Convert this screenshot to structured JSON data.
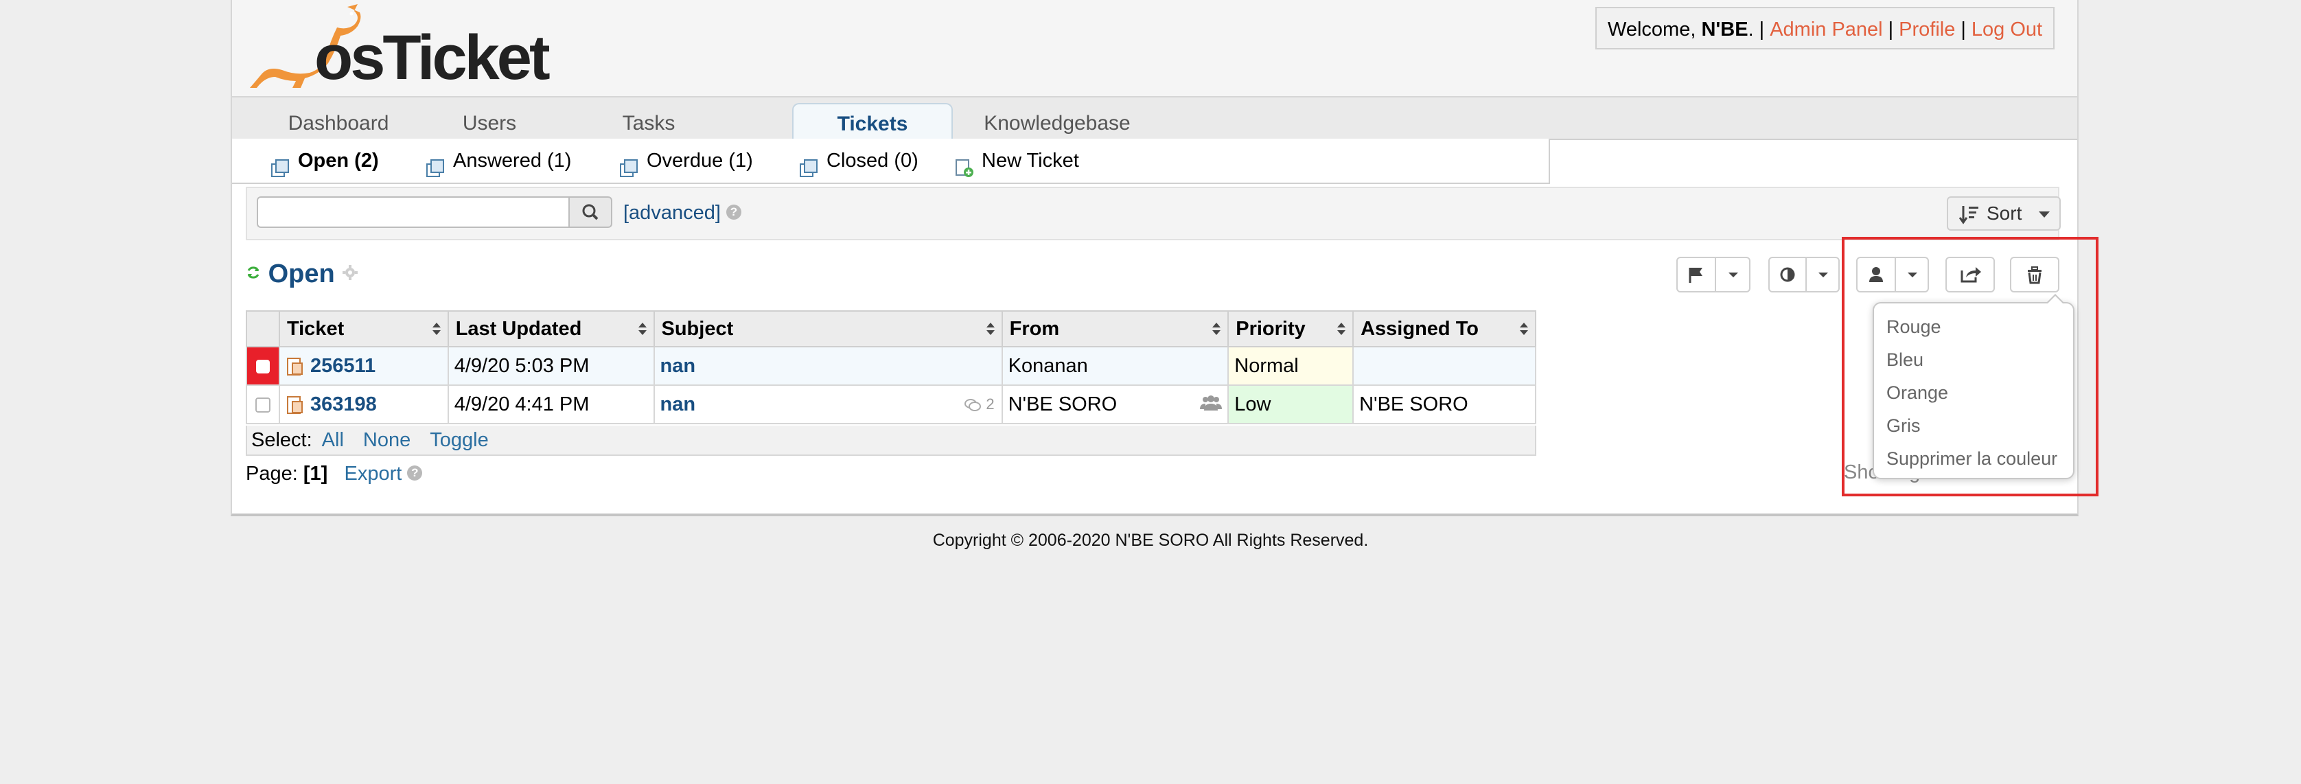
{
  "header": {
    "logo_text": "osTicket",
    "welcome_prefix": "Welcome, ",
    "username": "N'BE",
    "welcome_suffix": ".",
    "links": [
      "Admin Panel",
      "Profile",
      "Log Out"
    ]
  },
  "nav": {
    "tabs": [
      "Dashboard",
      "Users",
      "Tasks",
      "Tickets",
      "Knowledgebase"
    ],
    "active": "Tickets"
  },
  "subnav": {
    "items": [
      "Open (2)",
      "Answered (1)",
      "Overdue (1)",
      "Closed (0)",
      "New Ticket"
    ]
  },
  "search": {
    "placeholder": "",
    "advanced_label": "[advanced]",
    "help": "?",
    "sort_label": "Sort"
  },
  "queue": {
    "title": "Open"
  },
  "table": {
    "columns": [
      "Ticket",
      "Last Updated",
      "Subject",
      "From",
      "Priority",
      "Assigned To"
    ],
    "rows": [
      {
        "ticket": "256511",
        "updated": "4/9/20 5:03 PM",
        "subject": "nan",
        "thread_count": "",
        "from": "Konanan",
        "priority": "Normal",
        "assigned": ""
      },
      {
        "ticket": "363198",
        "updated": "4/9/20 4:41 PM",
        "subject": "nan",
        "thread_count": "2",
        "from": "N'BE SORO",
        "priority": "Low",
        "assigned": "N'BE SORO"
      }
    ]
  },
  "select": {
    "label": "Select:",
    "options": [
      "All",
      "None",
      "Toggle"
    ]
  },
  "pager": {
    "label": "Page:",
    "current": "[1]",
    "export": "Export",
    "showing": "Showing 1 - 2 of about 2"
  },
  "color_menu": {
    "items": [
      "Rouge",
      "Bleu",
      "Orange",
      "Gris",
      "Supprimer la couleur"
    ]
  },
  "footer": {
    "copyright": "Copyright © 2006-2020 N'BE SORO All Rights Reserved."
  },
  "colors": {
    "brand_blue": "#184e81",
    "link_orange": "#e2613f",
    "priority_normal": "#fffde8",
    "priority_low": "#e2fbe2",
    "highlight": "#e22c2c"
  }
}
